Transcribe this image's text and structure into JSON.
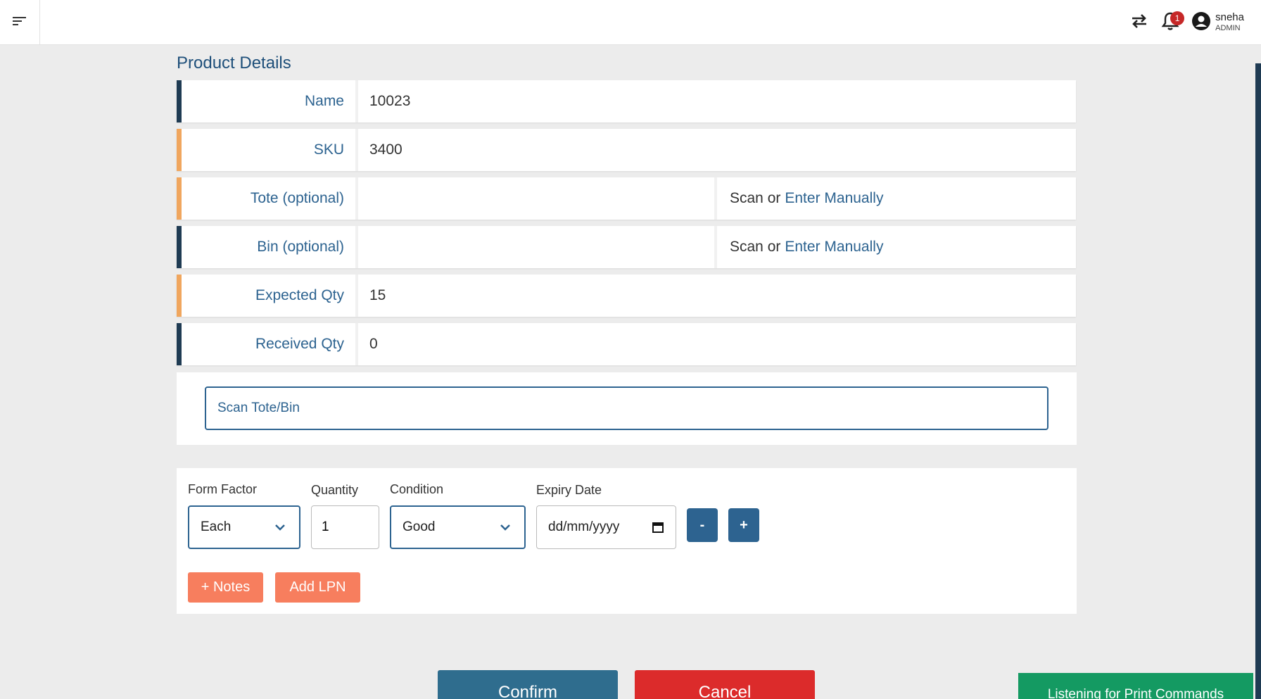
{
  "header": {
    "notification_count": "1",
    "user_name": "sneha",
    "user_role": "ADMIN"
  },
  "page": {
    "title": "Product Details"
  },
  "details": {
    "name_label": "Name",
    "name_value": "10023",
    "sku_label": "SKU",
    "sku_value": "3400",
    "tote_label": "Tote (optional)",
    "tote_scan_text": "Scan or",
    "tote_manual_link": "Enter Manually",
    "bin_label": "Bin (optional)",
    "bin_scan_text": "Scan or",
    "bin_manual_link": "Enter Manually",
    "expected_label": "Expected Qty",
    "expected_value": "15",
    "received_label": "Received Qty",
    "received_value": "0"
  },
  "scan": {
    "placeholder": "Scan Tote/Bin"
  },
  "form": {
    "form_factor_label": "Form Factor",
    "form_factor_value": "Each",
    "quantity_label": "Quantity",
    "quantity_value": "1",
    "condition_label": "Condition",
    "condition_value": "Good",
    "expiry_label": "Expiry Date",
    "expiry_placeholder": "dd/mm/yyyy",
    "minus_label": "-",
    "plus_label": "+",
    "notes_label": "+ Notes",
    "add_lpn_label": "Add LPN"
  },
  "actions": {
    "confirm_label": "Confirm",
    "cancel_label": "Cancel"
  },
  "status": {
    "print_banner": "Listening for Print Commands"
  },
  "colors": {
    "primary": "#2d6390",
    "dark_accent": "#1f3b53",
    "orange_accent": "#f0a65e",
    "notes_button": "#f77e5e",
    "cancel": "#dc2b2b",
    "print_banner": "#149a62"
  }
}
